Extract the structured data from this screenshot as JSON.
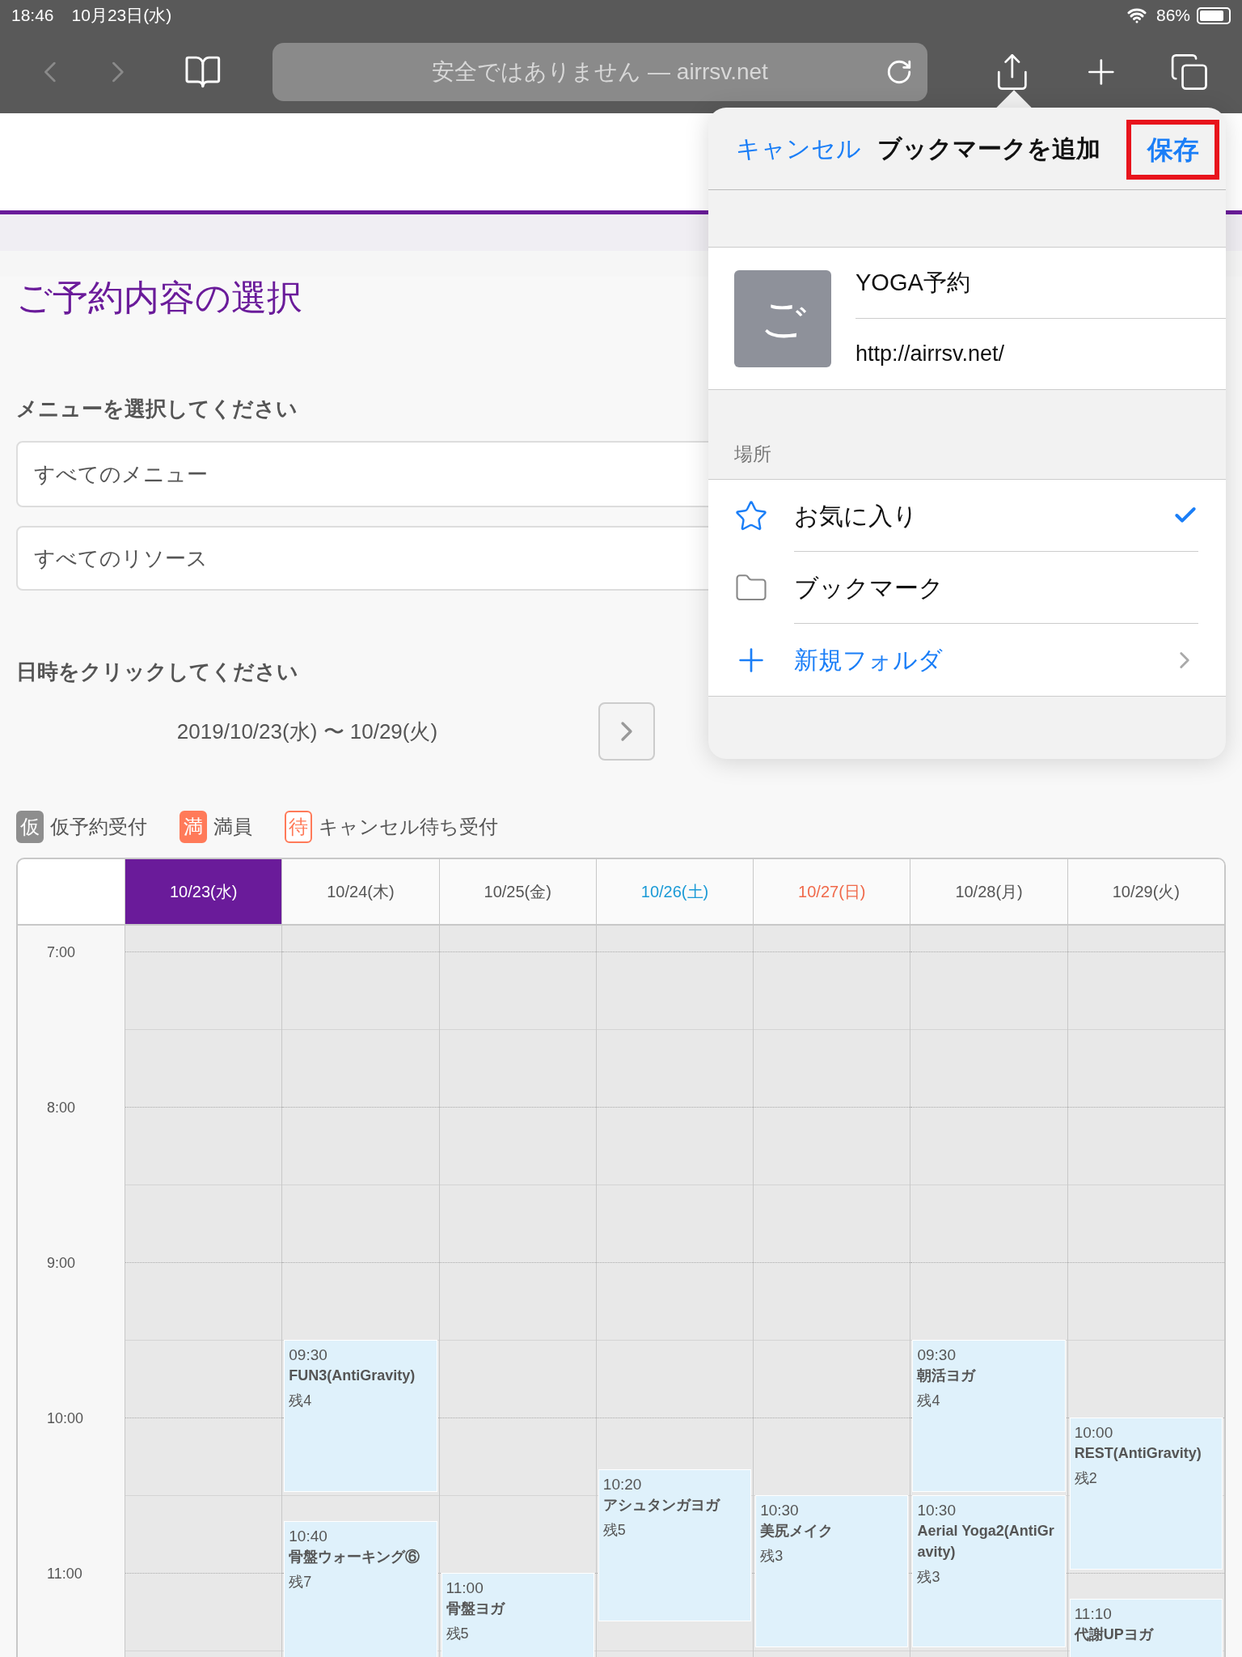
{
  "status_bar": {
    "time": "18:46",
    "date": "10月23日(水)",
    "battery": "86%"
  },
  "address_bar": {
    "text": "安全ではありません — airrsv.net"
  },
  "page": {
    "title": "ご予約内容の選択",
    "menu_label": "メニューを選択してください",
    "selects": [
      "すべてのメニュー",
      "すべてのリソース"
    ],
    "date_label": "日時をクリックしてください",
    "date_range": "2019/10/23(水) 〜 10/29(火)"
  },
  "legend": [
    {
      "mark": "仮",
      "label": "仮予約受付",
      "kind": "filled",
      "color": "#8e8e8e"
    },
    {
      "mark": "満",
      "label": "満員",
      "kind": "filled",
      "color": "#ff7a59"
    },
    {
      "mark": "待",
      "label": "キャンセル待ち受付",
      "kind": "outlined",
      "color": "#ff7a59"
    }
  ],
  "calendar": {
    "times": [
      "7:00",
      "8:00",
      "9:00",
      "10:00",
      "11:00"
    ],
    "days": [
      {
        "label": "10/23(水)",
        "selected": true,
        "kind": "weekday"
      },
      {
        "label": "10/24(木)",
        "selected": false,
        "kind": "weekday",
        "events": [
          {
            "time": "09:30",
            "title": "FUN3(AntiGravity)",
            "remaining": "残4"
          },
          {
            "time": "10:40",
            "title": "骨盤ウォーキング⑥",
            "remaining": "残7"
          }
        ]
      },
      {
        "label": "10/25(金)",
        "selected": false,
        "kind": "weekday",
        "events": [
          {
            "time": "11:00",
            "title": "骨盤ヨガ",
            "remaining": "残5"
          }
        ]
      },
      {
        "label": "10/26(土)",
        "selected": false,
        "kind": "saturday",
        "events": [
          {
            "time": "10:20",
            "title": "アシュタンガヨガ",
            "remaining": "残5"
          }
        ]
      },
      {
        "label": "10/27(日)",
        "selected": false,
        "kind": "sunday",
        "events": [
          {
            "time": "10:30",
            "title": "美尻メイク",
            "remaining": "残3"
          }
        ]
      },
      {
        "label": "10/28(月)",
        "selected": false,
        "kind": "weekday",
        "events": [
          {
            "time": "09:30",
            "title": "朝活ヨガ",
            "remaining": "残4"
          },
          {
            "time": "10:30",
            "title": "Aerial Yoga2(AntiGravity)",
            "remaining": "残3"
          }
        ]
      },
      {
        "label": "10/29(火)",
        "selected": false,
        "kind": "weekday",
        "events": [
          {
            "time": "10:00",
            "title": "REST(AntiGravity)",
            "remaining": "残2"
          },
          {
            "time": "11:10",
            "title": "代謝UPヨガ"
          }
        ]
      }
    ]
  },
  "bookmark_popover": {
    "cancel": "キャンセル",
    "title": "ブックマークを追加",
    "save": "保存",
    "save_highlighted": true,
    "icon_letter": "ご",
    "name": "YOGA予約",
    "url": "http://airrsv.net/",
    "location_label": "場所",
    "locations": [
      {
        "kind": "favorites",
        "label": "お気に入り",
        "selected": true
      },
      {
        "kind": "folder",
        "label": "ブックマーク",
        "selected": false
      },
      {
        "kind": "new-folder",
        "label": "新規フォルダ",
        "selected": false
      }
    ]
  }
}
